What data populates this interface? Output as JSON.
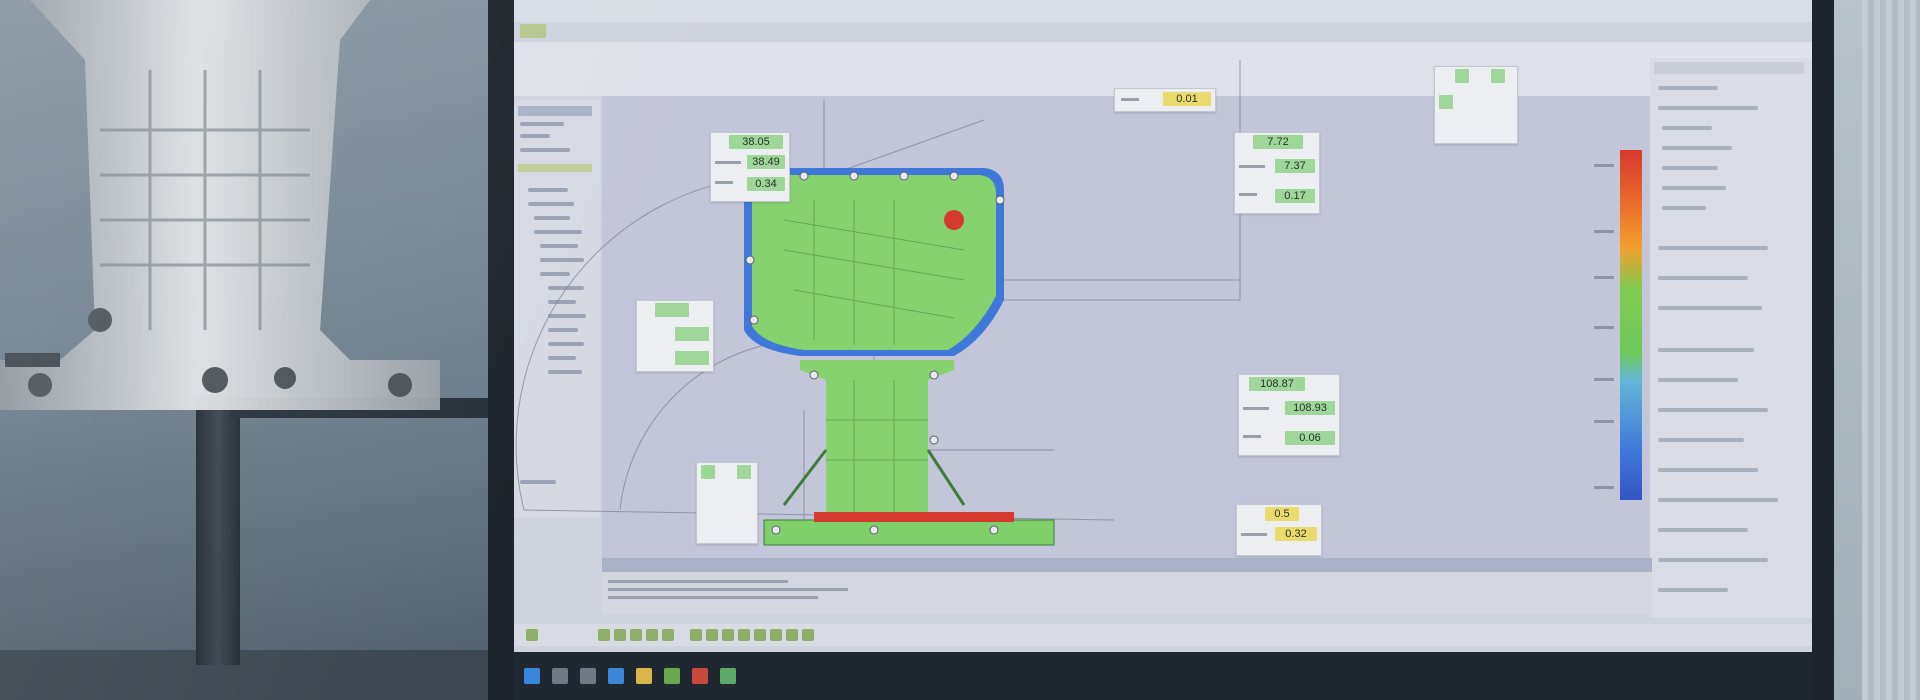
{
  "callouts": [
    {
      "id": "c1",
      "values": [
        "38.05",
        "38.49",
        "0.34"
      ]
    },
    {
      "id": "c2",
      "values": [
        "7.72",
        "7.37",
        "0.17"
      ]
    },
    {
      "id": "c3",
      "values": [
        "0.01"
      ]
    },
    {
      "id": "c4",
      "values": [
        "108.87",
        "108.93",
        "0.06"
      ]
    },
    {
      "id": "c5",
      "values": [
        "0.5",
        "0.32"
      ]
    }
  ],
  "colors": {
    "part_green": "#7fd06a",
    "deviation_red": "#d43a2e",
    "deviation_blue": "#3f78d8",
    "callout_green": "#9fd79a",
    "callout_yellow": "#e9db6c"
  }
}
